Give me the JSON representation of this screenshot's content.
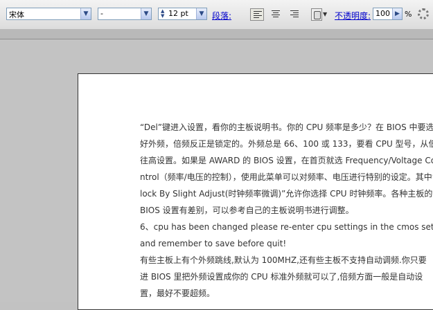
{
  "toolbar": {
    "font_family": "宋体",
    "font_style": "-",
    "font_size": "12 pt",
    "paragraph_label": "段落:",
    "opacity_label": "不透明度:",
    "opacity_value": "100",
    "percent": "%"
  },
  "document": {
    "lines": [
      "“Del”键进入设置，看你的主板说明书。你的 CPU 频率是多少？在 BIOS 中要选",
      "好外频，倍频反正是锁定的。外频总是 66、100 或 133，要看 CPU 型号，从低",
      "往高设置。如果是 AWARD 的 BIOS 设置，在首页就选 Frequency/Voltage Co",
      "ntrol（频率/电压的控制），使用此菜单可以对频率、电压进行特别的设定。其中“C",
      "lock By Slight Adjust(时钟频率微调)”允许你选择 CPU 时钟频率。各种主板的",
      "BIOS 设置有差别，可以参考自己的主板说明书进行调整。",
      "6、cpu has been changed please re-enter cpu settings in the cmos setup",
      "  and remember to save before quit!",
      "有些主板上有个外频跳线,默认为 100MHZ,还有些主板不支持自动调频.你只要",
      "进 BIOS 里把外频设置成你的 CPU 标准外频就可以了,倍频方面一般是自动设",
      "置，最好不要超频。"
    ]
  }
}
